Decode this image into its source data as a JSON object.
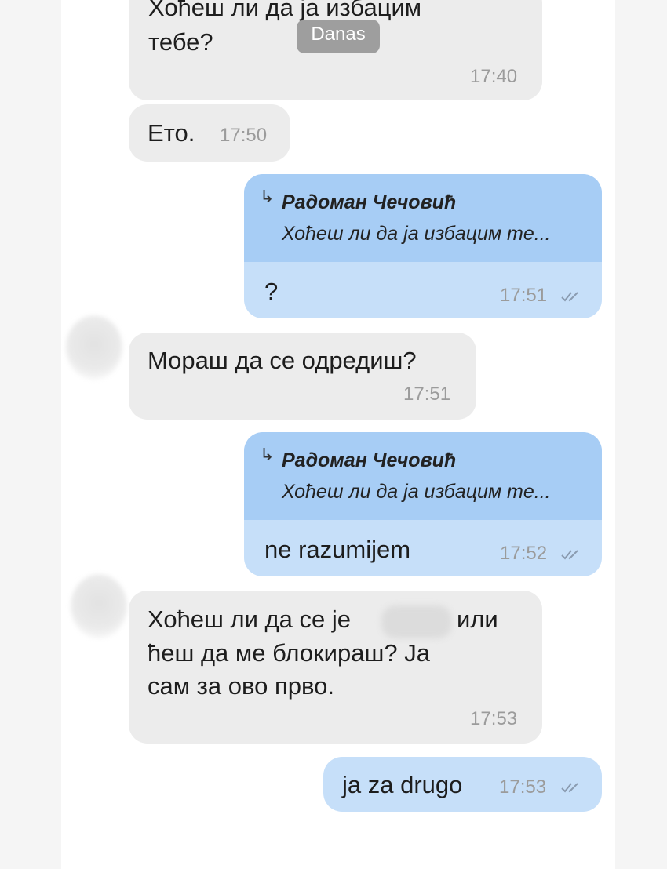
{
  "date_separator": "Danas",
  "messages": [
    {
      "type": "incoming",
      "text_cut": "Хоћеш ли да ја избацим",
      "text": "тебе?",
      "time": "17:40"
    },
    {
      "type": "incoming",
      "text": "Ето.",
      "time": "17:50"
    },
    {
      "type": "outgoing",
      "reply_to": {
        "name": "Радоман Чечовић",
        "text": "Хоћеш ли да ја избацим те..."
      },
      "text": "?",
      "time": "17:51",
      "status": "read"
    },
    {
      "type": "incoming",
      "text": "Мораш да се одредиш?",
      "time": "17:51"
    },
    {
      "type": "outgoing",
      "reply_to": {
        "name": "Радоман Чечовић",
        "text": "Хоћеш ли да ја избацим те..."
      },
      "text": "ne razumijem",
      "time": "17:52",
      "status": "read"
    },
    {
      "type": "incoming",
      "lines": [
        "Хоћеш ли да се је",
        "или",
        "ћеш да ме блокираш? Ја",
        "сам за ово прво."
      ],
      "time": "17:53"
    },
    {
      "type": "outgoing",
      "text": "ja za drugo",
      "time": "17:53",
      "status": "read"
    }
  ],
  "icons": {
    "reply": "reply-arrow-icon",
    "checks": "double-check-icon"
  },
  "colors": {
    "incoming": "#ececec",
    "outgoing": "#c6dff9",
    "quote": "#a7cdf5",
    "time": "#9b9b9b",
    "checks": "#8a9bb0"
  }
}
